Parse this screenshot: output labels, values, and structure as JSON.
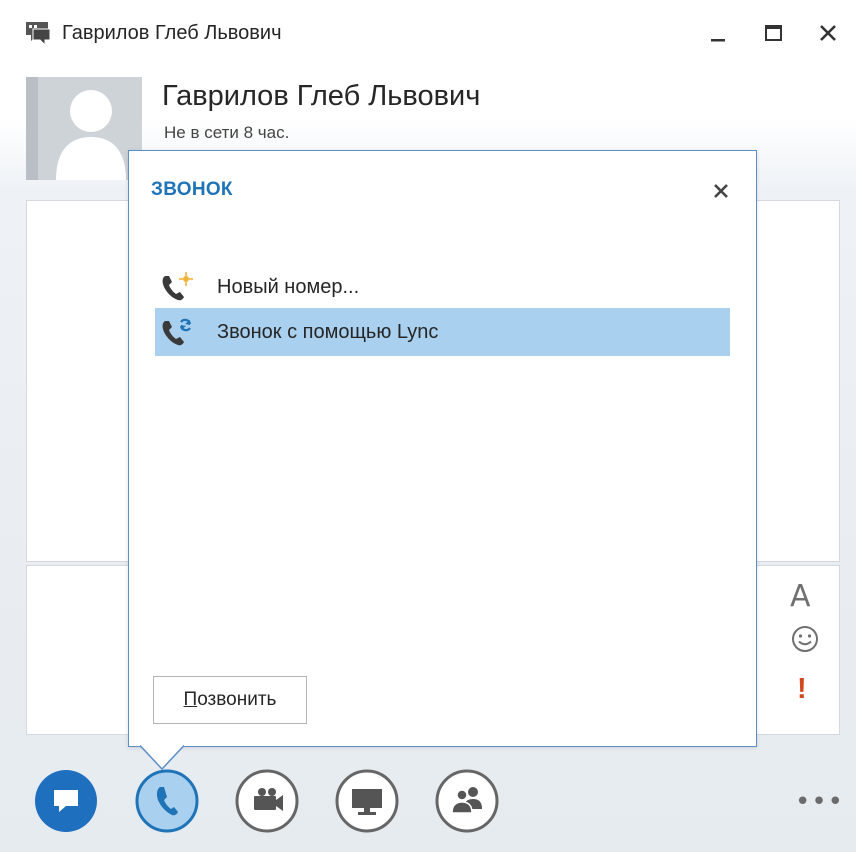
{
  "window": {
    "title": "Гаврилов Глеб Львович"
  },
  "contact": {
    "name": "Гаврилов Глеб Львович",
    "status": "Не в сети 8 час."
  },
  "call_popup": {
    "title": "ЗВОНОК",
    "options": [
      {
        "label": "Новый номер...",
        "icon": "new-number-phone-icon",
        "selected": false
      },
      {
        "label": "Звонок с помощью Lync",
        "icon": "lync-call-phone-icon",
        "selected": true
      }
    ],
    "call_button": {
      "accelerator": "П",
      "rest": "озвонить"
    }
  },
  "side_tools": {
    "font_glyph": "A",
    "importance_glyph": "!"
  },
  "toolbar": {
    "buttons": [
      "im-icon",
      "phone-icon",
      "video-camera-icon",
      "presentation-monitor-icon",
      "add-people-icon"
    ],
    "more_label": "•••"
  },
  "colors": {
    "accent": "#1f73b7",
    "selection": "#a9d0ee",
    "popup_border": "#5c8fc5",
    "importance": "#d04a1e"
  }
}
